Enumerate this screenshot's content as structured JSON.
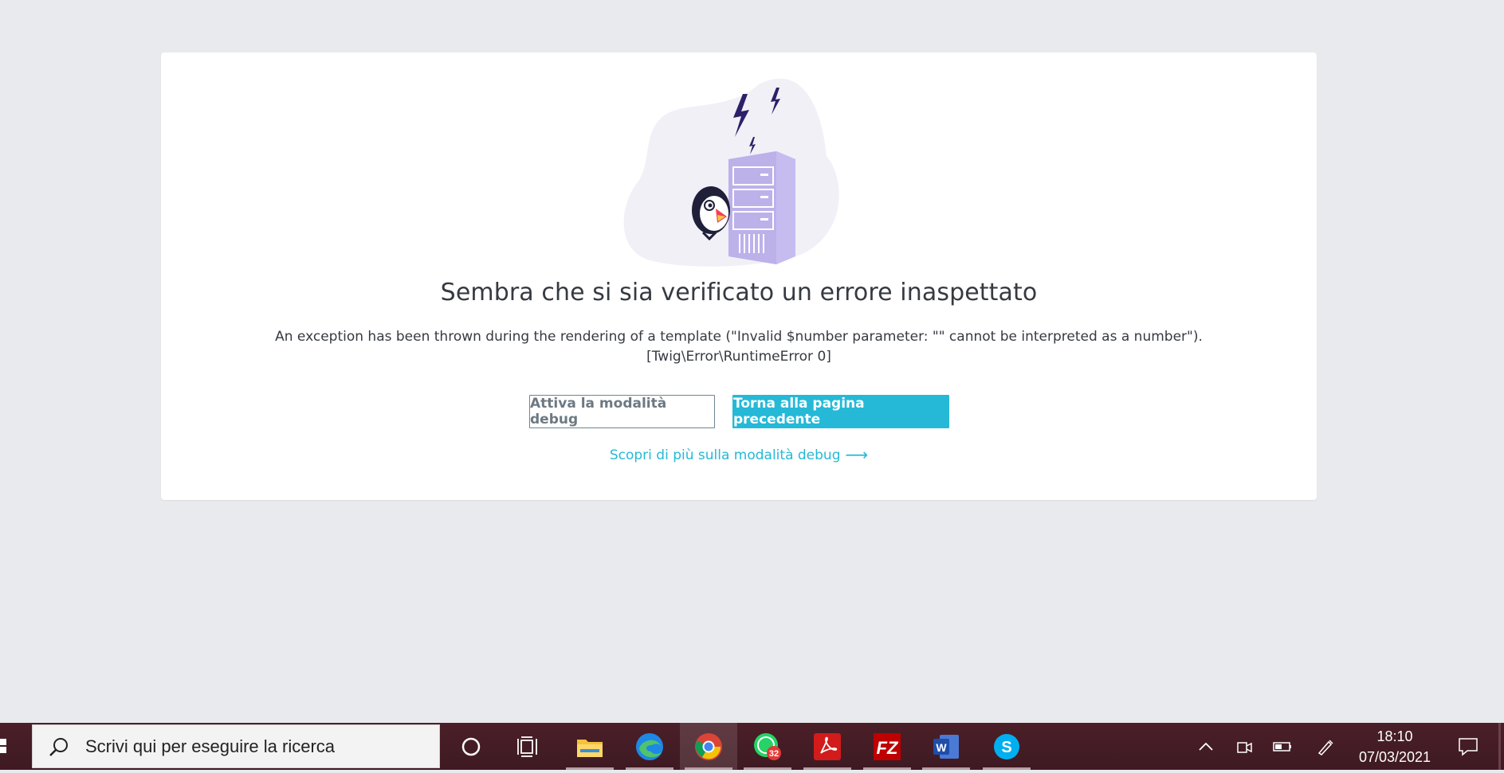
{
  "error_page": {
    "title": "Sembra che si sia verificato un errore inaspettato",
    "message_line1": "An exception has been thrown during the rendering of a template (\"Invalid $number parameter: \"\" cannot be interpreted as a number\").",
    "message_line2": "[Twig\\Error\\RuntimeError 0]",
    "debug_button": "Attiva la modalità debug",
    "back_button": "Torna alla pagina precedente",
    "learn_more_link": "Scopri di più sulla modalità debug",
    "link_arrow": "⟶"
  },
  "taskbar": {
    "search_placeholder": "Scrivi qui per eseguire la ricerca",
    "apps": [
      {
        "name": "cortana",
        "icon": "circle-icon"
      },
      {
        "name": "task-view",
        "icon": "task-view-icon"
      },
      {
        "name": "file-explorer",
        "icon": "folder-icon"
      },
      {
        "name": "edge",
        "icon": "edge-icon"
      },
      {
        "name": "chrome",
        "icon": "chrome-icon",
        "active": true
      },
      {
        "name": "whatsapp",
        "icon": "whatsapp-icon",
        "badge": "32"
      },
      {
        "name": "acrobat",
        "icon": "acrobat-icon"
      },
      {
        "name": "filezilla",
        "icon": "filezilla-icon"
      },
      {
        "name": "word",
        "icon": "word-icon"
      },
      {
        "name": "skype",
        "icon": "skype-icon"
      }
    ],
    "whatsapp_badge": "32",
    "time": "18:10",
    "date": "07/03/2021"
  },
  "colors": {
    "background": "#e9eaed",
    "accent": "#25b9d7",
    "text": "#363a41",
    "taskbar": "#4b1f28"
  }
}
